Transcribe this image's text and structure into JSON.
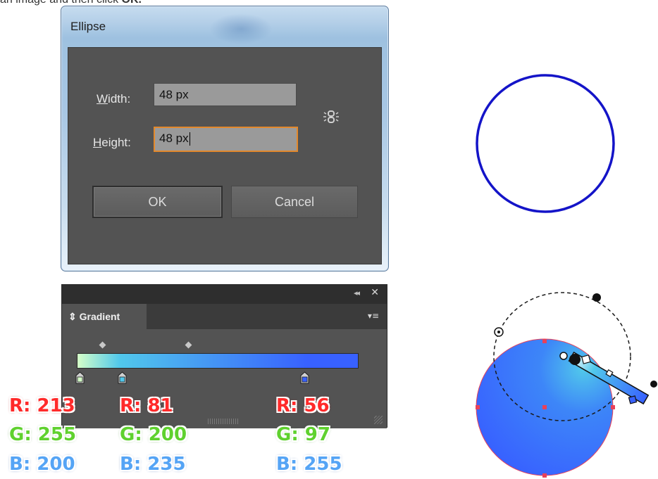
{
  "caption": {
    "text": "an image and then click ",
    "bold": "OK."
  },
  "ellipse_dialog": {
    "title": "Ellipse",
    "width_label_accel": "W",
    "width_label_rest": "idth:",
    "width_value": "48 px",
    "height_label_accel": "H",
    "height_label_rest": "eight:",
    "height_value": "48 px",
    "ok_label": "OK",
    "cancel_label": "Cancel",
    "link_icon": "constrain-proportions-icon"
  },
  "gradient_panel": {
    "tab_label": "Gradient",
    "tab_arrows": "⇕",
    "collapse_glyph": "◂◂",
    "close_glyph": "✕",
    "menu_glyph": "▾≡",
    "gradient_colors": [
      "#d5ffc8",
      "#51c8eb",
      "#3861ff"
    ]
  },
  "color_stops": [
    {
      "r": "R: 213",
      "g": "G: 255",
      "b": "B: 200"
    },
    {
      "r": "R: 81",
      "g": "G: 200",
      "b": "B: 235"
    },
    {
      "r": "R: 56",
      "g": "G: 97",
      "b": "B: 255"
    }
  ],
  "colors": {
    "circle_stroke": "#1414c8",
    "fill_gradient_start": "#51c8eb",
    "fill_gradient_end": "#3861ff",
    "selection_point": "#e8415a"
  }
}
